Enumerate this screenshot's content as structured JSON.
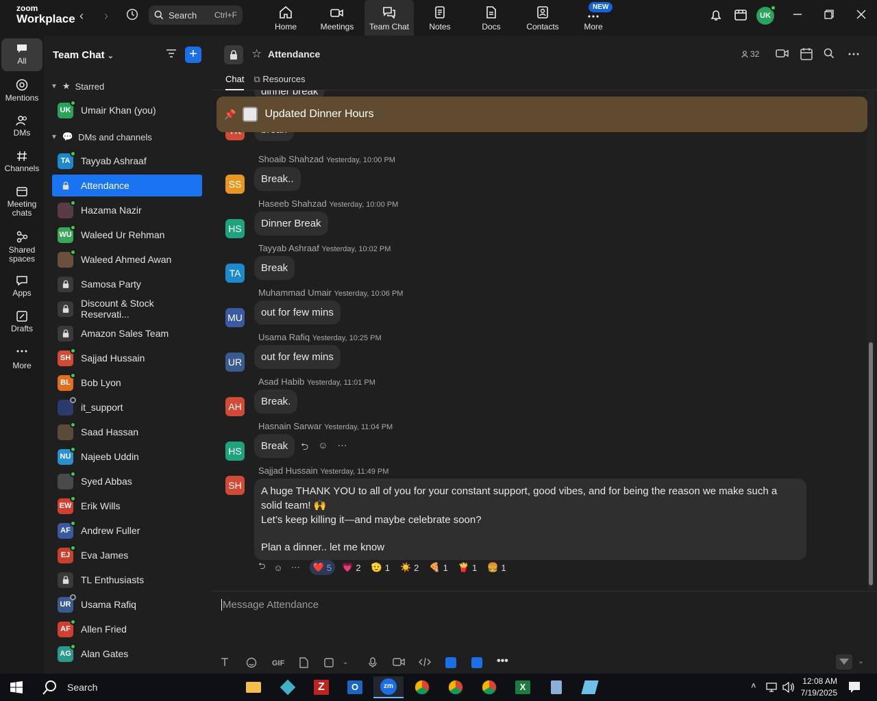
{
  "app": {
    "brand_small": "zoom",
    "brand_large": "Workplace"
  },
  "topbar": {
    "search_label": "Search",
    "search_shortcut": "Ctrl+F",
    "nav": [
      {
        "label": "Home",
        "icon": "home-icon"
      },
      {
        "label": "Meetings",
        "icon": "video-camera-icon"
      },
      {
        "label": "Team Chat",
        "icon": "chat-icon"
      },
      {
        "label": "Notes",
        "icon": "notes-icon"
      },
      {
        "label": "Docs",
        "icon": "docs-icon"
      },
      {
        "label": "Contacts",
        "icon": "contacts-icon"
      },
      {
        "label": "More",
        "icon": "more-dots-icon"
      }
    ],
    "new_badge": "NEW",
    "user_initials": "UK"
  },
  "rail": [
    {
      "label": "All"
    },
    {
      "label": "Mentions"
    },
    {
      "label": "DMs"
    },
    {
      "label": "Channels"
    },
    {
      "label": "Meeting chats"
    },
    {
      "label": "Shared spaces"
    },
    {
      "label": "Apps"
    },
    {
      "label": "Drafts"
    },
    {
      "label": "More"
    }
  ],
  "sidebar": {
    "title": "Team Chat",
    "starred_label": "Starred",
    "starred": [
      {
        "initials": "UK",
        "name": "Umair Khan (you)",
        "color": "#2aa45c"
      }
    ],
    "dms_label": "DMs and channels",
    "items": [
      {
        "initials": "TA",
        "name": "Tayyab Ashraaf",
        "color": "#1d8ad0"
      },
      {
        "initials": "",
        "name": "Attendance",
        "color": "#1a73f0"
      },
      {
        "initials": "",
        "name": "Hazama Nazir",
        "color": "#5a3a45"
      },
      {
        "initials": "WU",
        "name": "Waleed Ur Rehman",
        "color": "#3aa85a"
      },
      {
        "initials": "",
        "name": "Waleed Ahmed Awan",
        "color": "#6b5040"
      },
      {
        "initials": "",
        "name": "Samosa Party",
        "color": "#3a3a3a"
      },
      {
        "initials": "",
        "name": "Discount & Stock Reservati...",
        "color": "#3a3a3a"
      },
      {
        "initials": "",
        "name": "Amazon Sales Team",
        "color": "#3a3a3a"
      },
      {
        "initials": "SH",
        "name": "Sajjad Hussain",
        "color": "#d04a35"
      },
      {
        "initials": "BL",
        "name": "Bob Lyon",
        "color": "#e07020"
      },
      {
        "initials": "",
        "name": "it_support",
        "color": "#2a3a6a"
      },
      {
        "initials": "",
        "name": "Saad Hassan",
        "color": "#5a4a3a"
      },
      {
        "initials": "NU",
        "name": "Najeeb Uddin",
        "color": "#2c8fd0"
      },
      {
        "initials": "",
        "name": "Syed Abbas",
        "color": "#4a4a4a"
      },
      {
        "initials": "EW",
        "name": "Erik Wills",
        "color": "#d04030"
      },
      {
        "initials": "AF",
        "name": "Andrew Fuller",
        "color": "#3a5aa0"
      },
      {
        "initials": "EJ",
        "name": "Eva James",
        "color": "#c8402e"
      },
      {
        "initials": "",
        "name": "TL Enthusiasts",
        "color": "#3a3a3a"
      },
      {
        "initials": "UR",
        "name": "Usama Rafiq",
        "color": "#3a5a90"
      },
      {
        "initials": "AF",
        "name": "Allen Fried",
        "color": "#d04030"
      },
      {
        "initials": "AG",
        "name": "Alan Gates",
        "color": "#2a9a8a"
      }
    ]
  },
  "chat": {
    "title": "Attendance",
    "tabs": [
      "Chat",
      "Resources"
    ],
    "member_count": "32",
    "pinned_text": "Updated Dinner Hours",
    "partial_top_text": "dinner break",
    "partial_break_text": "break",
    "partial_avatar": "TK",
    "messages": [
      {
        "initials": "SS",
        "color": "#e89820",
        "author": "Shoaib Shahzad",
        "time": "Yesterday, 10:00 PM",
        "text": "Break.."
      },
      {
        "initials": "HS",
        "color": "#1fa37c",
        "author": "Haseeb Shahzad",
        "time": "Yesterday, 10:00 PM",
        "text": "Dinner Break"
      },
      {
        "initials": "TA",
        "color": "#1d8ad0",
        "author": "Tayyab Ashraaf",
        "time": "Yesterday, 10:02 PM",
        "text": "Break"
      },
      {
        "initials": "MU",
        "color": "#3a5aa0",
        "author": "Muhammad Umair",
        "time": "Yesterday, 10:06 PM",
        "text": "out for few mins"
      },
      {
        "initials": "UR",
        "color": "#3a5a90",
        "author": "Usama Rafiq",
        "time": "Yesterday, 10:25 PM",
        "text": "out for few mins"
      },
      {
        "initials": "AH",
        "color": "#d04a35",
        "author": "Asad Habib",
        "time": "Yesterday, 11:01 PM",
        "text": "Break."
      },
      {
        "initials": "HS",
        "color": "#1fa37c",
        "author": "Hasnain Sarwar",
        "time": "Yesterday, 11:04 PM",
        "text": "Break"
      }
    ],
    "last_message": {
      "initials": "SH",
      "color": "#d04a35",
      "author": "Sajjad Hussain",
      "time": "Yesterday, 11:49 PM",
      "line1": "A huge THANK YOU to all of you for your constant support, good vibes, and for being the reason we make such a solid team! 🙌",
      "line2": "Let’s keep killing it—and maybe celebrate soon?",
      "line3": "Plan a dinner.. let me know",
      "reactions": [
        {
          "emoji": "❤️",
          "count": "5",
          "mine": true
        },
        {
          "emoji": "💗",
          "count": "2"
        },
        {
          "emoji": "🫡",
          "count": "1"
        },
        {
          "emoji": "☀️",
          "count": "2"
        },
        {
          "emoji": "🍕",
          "count": "1"
        },
        {
          "emoji": "🍟",
          "count": "1"
        },
        {
          "emoji": "🍔",
          "count": "1"
        }
      ]
    },
    "composer_placeholder": "Message Attendance",
    "gif_label": "GIF"
  },
  "taskbar": {
    "search_label": "Search",
    "time": "12:08 AM",
    "date": "7/19/2025"
  }
}
